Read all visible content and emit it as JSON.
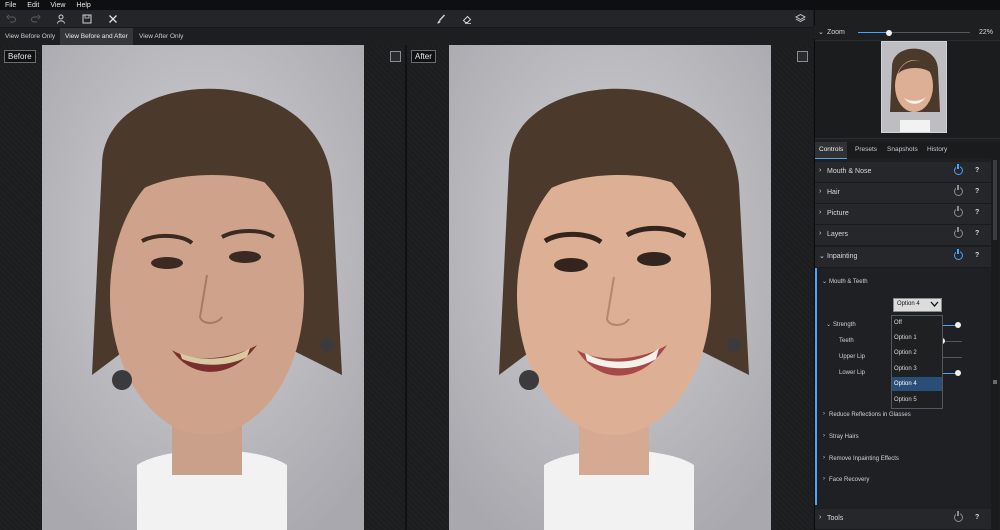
{
  "menu": [
    "File",
    "Edit",
    "View",
    "Help"
  ],
  "toolbar": {
    "undo_icon": "undo-icon",
    "redo_icon": "redo-icon",
    "person_icon": "person-icon",
    "save_icon": "save-icon",
    "close_icon": "close-icon",
    "brush_icon": "brush-icon",
    "eraser_icon": "eraser-icon",
    "layers_icon": "layers-icon"
  },
  "view_tabs": [
    {
      "label": "View Before Only",
      "active": false
    },
    {
      "label": "View Before and After",
      "active": true
    },
    {
      "label": "View After Only",
      "active": false
    }
  ],
  "panes": {
    "before_label": "Before",
    "after_label": "After"
  },
  "zoom": {
    "label": "Zoom",
    "value": "22%",
    "level": 0.28
  },
  "control_tabs": [
    {
      "label": "Controls",
      "active": true
    },
    {
      "label": "Presets",
      "active": false
    },
    {
      "label": "Snapshots",
      "active": false
    },
    {
      "label": "History",
      "active": false
    }
  ],
  "sections": [
    {
      "label": "Mouth & Nose",
      "enabled": true,
      "expanded": false
    },
    {
      "label": "Hair",
      "enabled": false,
      "expanded": false
    },
    {
      "label": "Picture",
      "enabled": false,
      "expanded": false
    },
    {
      "label": "Layers",
      "enabled": false,
      "expanded": false
    },
    {
      "label": "Inpainting",
      "enabled": true,
      "expanded": true
    }
  ],
  "inpainting": {
    "subsection": "Mouth & Teeth",
    "dropdown_value": "Option 4",
    "dropdown_options": [
      "Off",
      "Option 1",
      "Option 2",
      "Option 3",
      "Option 4",
      "Option 5"
    ],
    "dropdown_selected_index": 4,
    "strength": {
      "label": "Strength",
      "rows": [
        {
          "label": "Teeth"
        },
        {
          "label": "Upper Lip"
        },
        {
          "label": "Lower Lip"
        }
      ]
    },
    "more": [
      "Reduce Reflections in Glasses",
      "Stray Hairs",
      "Remove Inpainting Effects",
      "Face Recovery"
    ]
  },
  "tools_section": {
    "label": "Tools",
    "enabled": false
  },
  "help_symbol": "?",
  "colors": {
    "accent": "#4aa3ff",
    "panel": "#26272a",
    "background": "#1b1c1e"
  }
}
